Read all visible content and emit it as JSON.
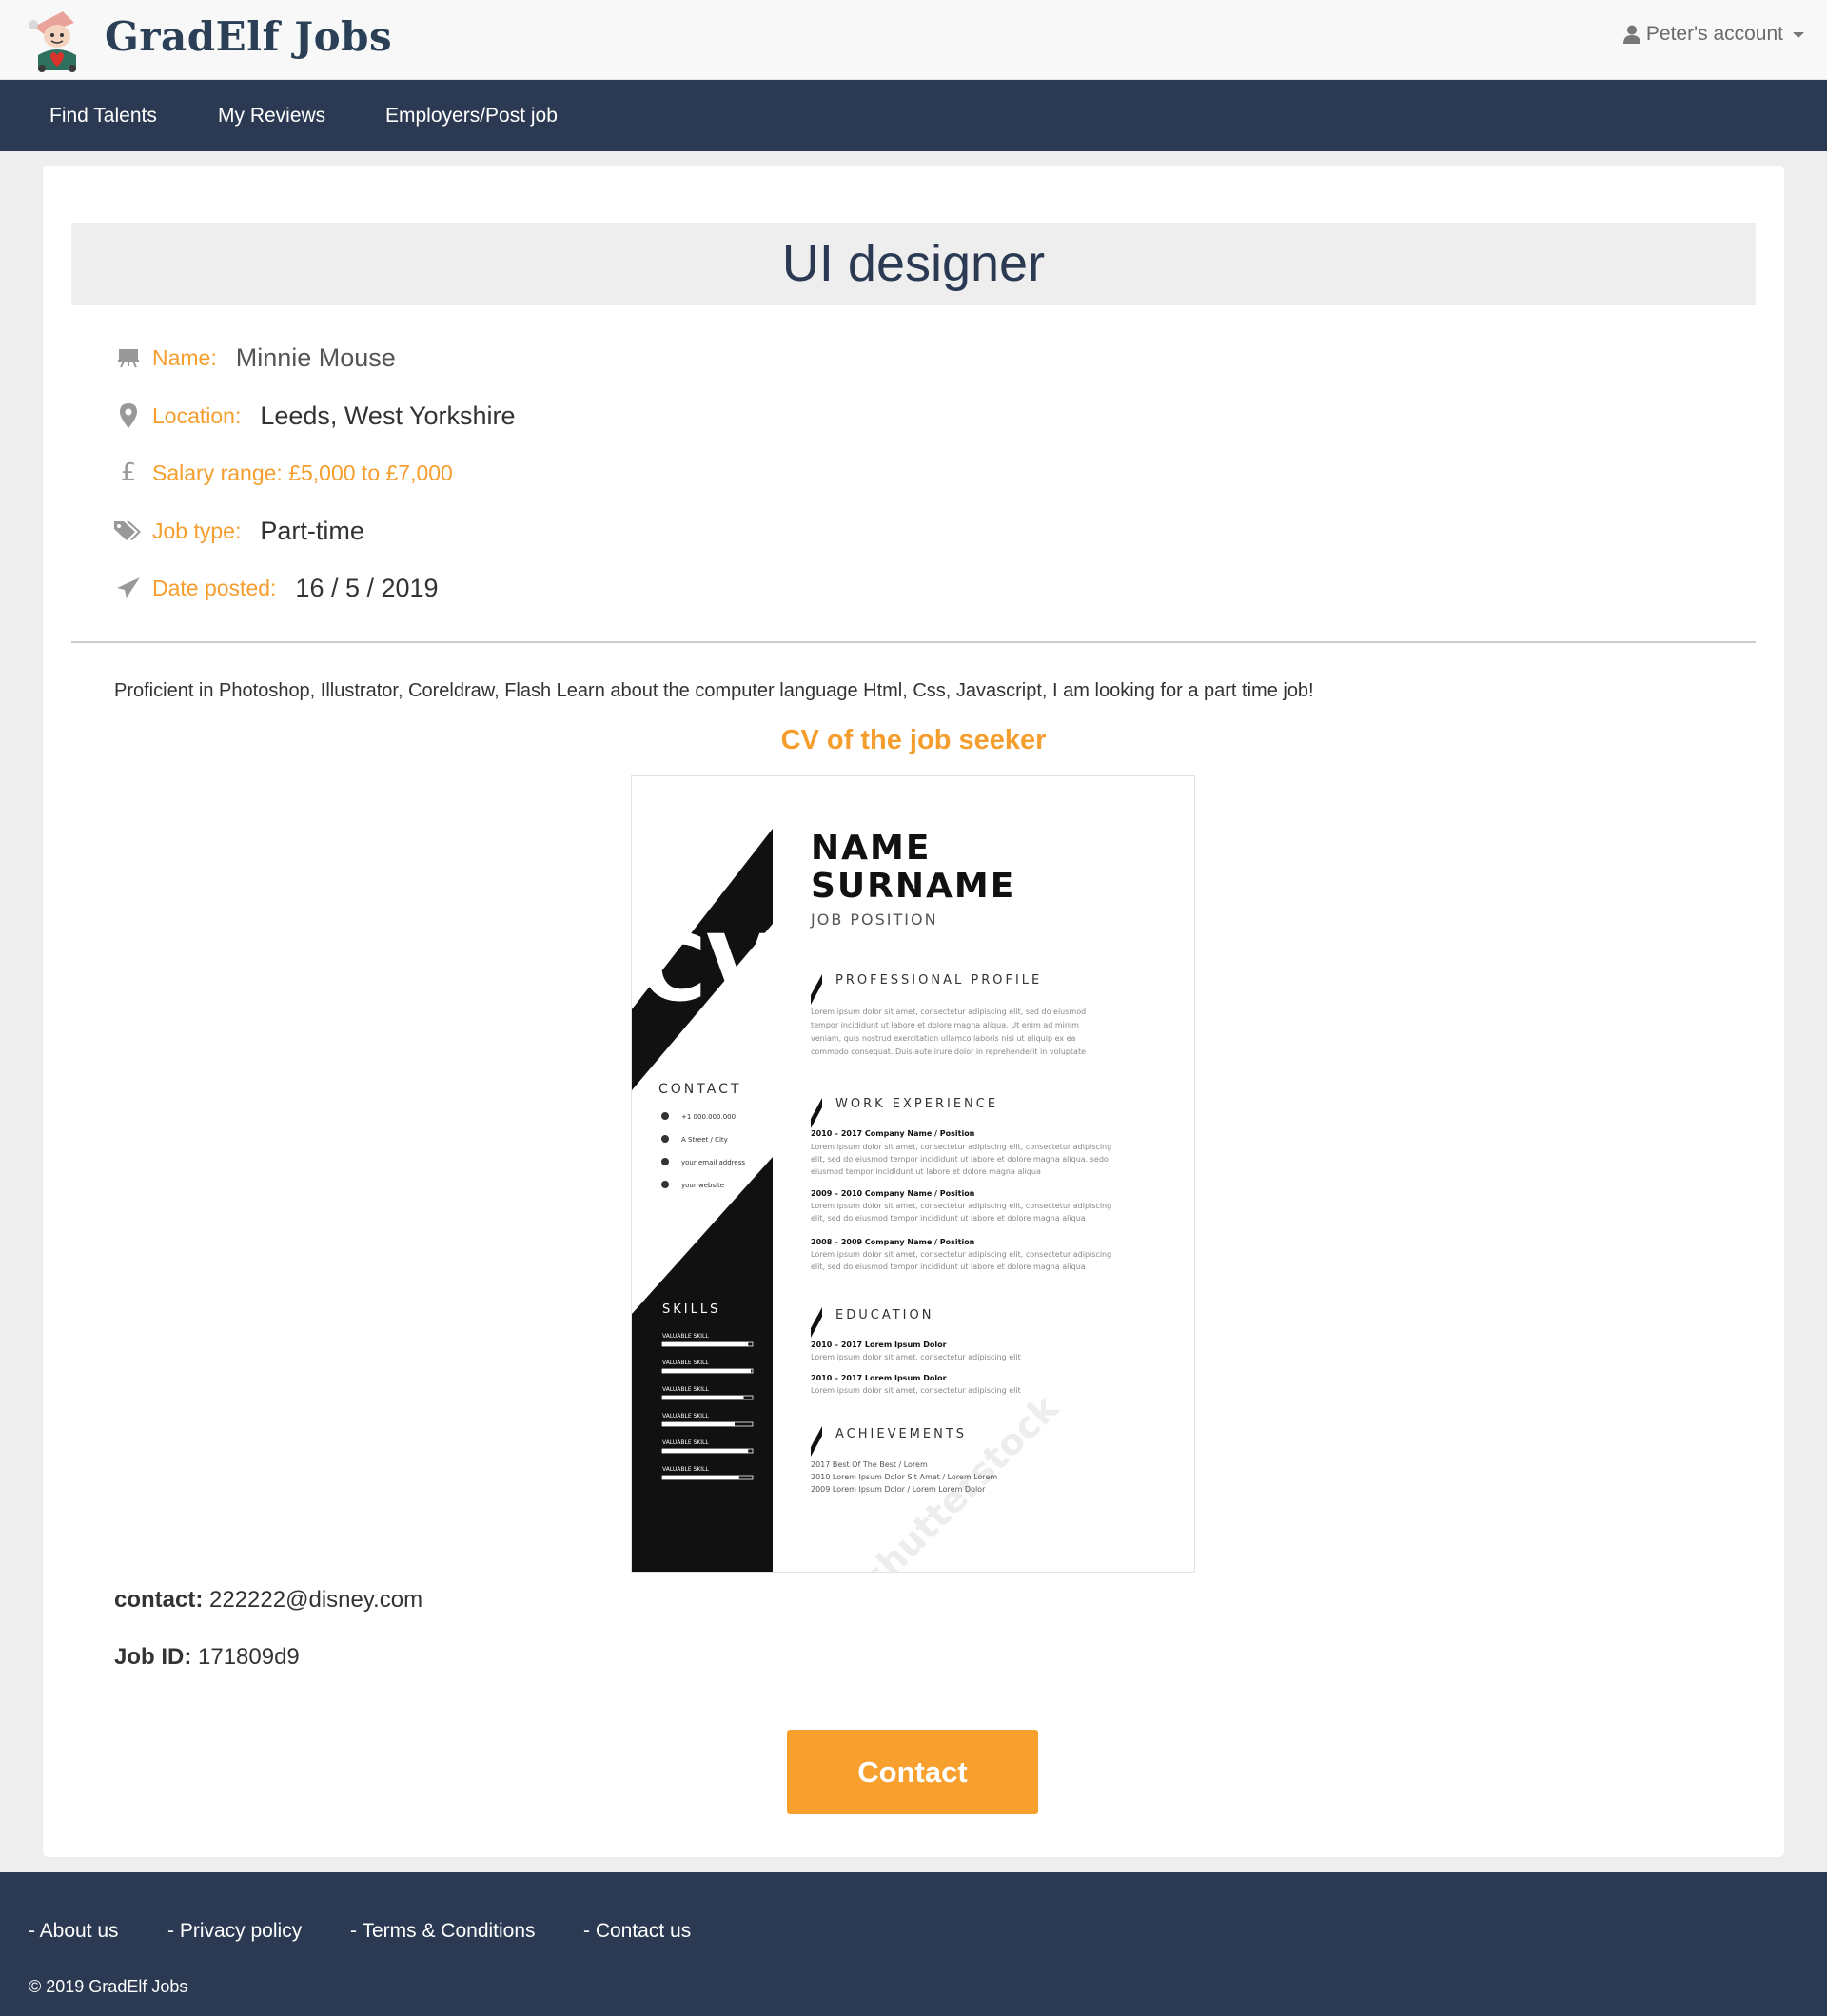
{
  "header": {
    "brand": "GradElf Jobs",
    "account_label": "Peter's account"
  },
  "nav": {
    "items": [
      {
        "label": "Find Talents"
      },
      {
        "label": "My Reviews"
      },
      {
        "label": "Employers/Post job"
      }
    ]
  },
  "job": {
    "title": "UI designer",
    "name_label": "Name:",
    "name_value": "Minnie Mouse",
    "location_label": "Location:",
    "location_value": "Leeds, West Yorkshire",
    "salary_label": "Salary range: £5,000 to £7,000",
    "jobtype_label": "Job type:",
    "jobtype_value": "Part-time",
    "date_label": "Date posted:",
    "date_value": "16 / 5 / 2019",
    "description": "Proficient in Photoshop, Illustrator, Coreldraw, Flash Learn about the computer language Html, Css, Javascript, I am looking for a part time job!",
    "cv_heading": "CV of the job seeker",
    "contact_label": "contact:",
    "contact_value": "222222@disney.com",
    "jobid_label": "Job ID:",
    "jobid_value": "171809d9",
    "contact_button": "Contact"
  },
  "cv": {
    "letters": "CV",
    "name_line1": "NAME",
    "name_line2": "SURNAME",
    "position": "JOB POSITION",
    "section_profile": "PROFESSIONAL PROFILE",
    "profile_text": [
      "Lorem ipsum dolor sit amet, consectetur adipiscing elit, sed do eiusmod",
      "tempor incididunt ut labore et dolore magna aliqua. Ut enim ad minim",
      "veniam, quis nostrud exercitation ullamco laboris nisi ut aliquip ex ea",
      "commodo consequat. Duis aute irure dolor in reprehenderit in voluptate"
    ],
    "section_work": "WORK EXPERIENCE",
    "work": [
      {
        "head": "2010 – 2017   Company Name / Position",
        "lines": [
          "Lorem ipsum dolor sit amet, consectetur adipiscing elit, consectetur adipiscing",
          "elit, sed do eiusmod tempor incididunt ut labore et dolore magna aliqua. sedo",
          "eiusmod tempor incididunt ut labore et dolore magna aliqua"
        ]
      },
      {
        "head": "2009 – 2010   Company Name / Position",
        "lines": [
          "Lorem ipsum dolor sit amet, consectetur adipiscing elit, consectetur adipiscing",
          "elit, sed do eiusmod tempor incididunt ut labore et dolore magna aliqua"
        ]
      },
      {
        "head": "2008 – 2009   Company Name / Position",
        "lines": [
          "Lorem ipsum dolor sit amet, consectetur adipiscing elit, consectetur adipiscing",
          "elit, sed do eiusmod tempor incididunt ut labore et dolore magna aliqua"
        ]
      }
    ],
    "section_education": "EDUCATION",
    "education": [
      {
        "head": "2010 – 2017   Lorem Ipsum Dolor",
        "line": "Lorem ipsum dolor sit amet, consectetur adipiscing elit"
      },
      {
        "head": "2010 – 2017   Lorem Ipsum Dolor",
        "line": "Lorem ipsum dolor sit amet, consectetur adipiscing elit"
      }
    ],
    "section_achievements": "ACHIEVEMENTS",
    "achievements": [
      "2017   Best Of The Best / Lorem",
      "2010   Lorem Ipsum Dolor Sit Amet / Lorem Lorem",
      "2009   Lorem Ipsum Dolor / Lorem Lorem Dolor"
    ],
    "contact_title": "CONTACT",
    "contact_items": [
      "+1 000.000.000",
      "A Street / City",
      "your email address",
      "your website"
    ],
    "skills_title": "SKILLS",
    "skills": [
      {
        "label": "VALUABLE SKILL",
        "level": 0.95
      },
      {
        "label": "VALUABLE SKILL",
        "level": 0.98
      },
      {
        "label": "VALUABLE SKILL",
        "level": 0.9
      },
      {
        "label": "VALUABLE SKILL",
        "level": 0.8
      },
      {
        "label": "VALUABLE SKILL",
        "level": 0.95
      },
      {
        "label": "VALUABLE SKILL",
        "level": 0.85
      }
    ],
    "watermark": "shutterstock"
  },
  "footer": {
    "links": [
      {
        "label": "- About us"
      },
      {
        "label": "- Privacy policy"
      },
      {
        "label": "- Terms & Conditions"
      },
      {
        "label": "- Contact us"
      }
    ],
    "copyright": "© 2019 GradElf Jobs"
  },
  "colors": {
    "navy": "#2b3a52",
    "orange": "#f59e2e",
    "button": "#f7a02e",
    "page_bg": "#eeeeee"
  },
  "icons": [
    "elf-logo",
    "user-icon",
    "chevron-down-icon",
    "easel-icon",
    "map-marker-icon",
    "pound-icon",
    "tags-icon",
    "send-icon"
  ]
}
